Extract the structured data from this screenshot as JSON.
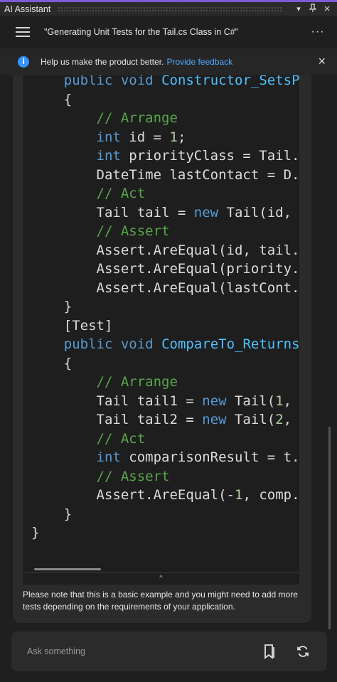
{
  "window": {
    "title": "AI Assistant",
    "dropdown_icon": "chevron-down-icon",
    "pin_icon": "pin-icon",
    "close_glyph": "×"
  },
  "header": {
    "menu_icon": "hamburger-icon",
    "conversation_title": "\"Generating Unit Tests for the Tail.cs Class in C#\"",
    "more_label": "···"
  },
  "feedback": {
    "info_glyph": "i",
    "message": "Help us make the product better.",
    "link": "Provide feedback",
    "close_glyph": "×"
  },
  "code": {
    "language": "C#",
    "lines": [
      "    public void Constructor_SetsPropertiesCorrectly()",
      "    {",
      "        // Arrange",
      "        int id = 1;",
      "        int priorityClass = Tail...",
      "        DateTime lastContact = D...",
      "        // Act",
      "        Tail tail = new Tail(id, ...",
      "        // Assert",
      "        Assert.AreEqual(id, tail...",
      "        Assert.AreEqual(priority...",
      "        Assert.AreEqual(lastCont...",
      "    }",
      "    [Test]",
      "    public void CompareTo_Returns...",
      "    {",
      "        // Arrange",
      "        Tail tail1 = new Tail(1, ...",
      "        Tail tail2 = new Tail(2, ...",
      "        // Act",
      "        int comparisonResult = t...",
      "        // Assert",
      "        Assert.AreEqual(-1, comp...",
      "    }",
      "}"
    ]
  },
  "collapse_glyph": "^",
  "note": "Please note that this is a basic example and you might need to add more tests depending on the requirements of your application.",
  "input": {
    "placeholder": "Ask something",
    "bookmark_icon": "bookmark-icon",
    "refresh_icon": "refresh-icon"
  },
  "colors": {
    "accent": "#7b5cd6",
    "link": "#4ea9ff",
    "keyword": "#569cd6",
    "method": "#4fc1ff",
    "comment": "#57a64a",
    "number": "#b5cea8"
  }
}
